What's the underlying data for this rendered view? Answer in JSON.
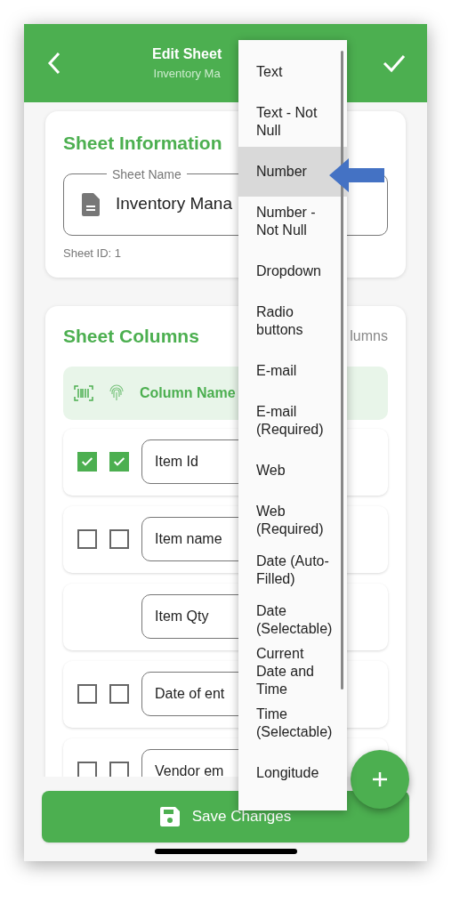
{
  "header": {
    "title": "Edit Sheet",
    "subtitle": "Inventory Ma"
  },
  "sheet_info": {
    "title": "Sheet Information",
    "field_label": "Sheet Name",
    "field_value": "Inventory Mana",
    "sheet_id": "Sheet ID: 1"
  },
  "columns_card": {
    "title": "Sheet Columns",
    "count": "lumns",
    "header_label": "Column Name"
  },
  "rows": [
    {
      "kind": "check",
      "name": "Item Id",
      "scan_checked": true,
      "secure_checked": true
    },
    {
      "kind": "check",
      "name": "Item name",
      "scan_checked": false,
      "secure_checked": false
    },
    {
      "kind": "plain",
      "name": "Item Qty"
    },
    {
      "kind": "check",
      "name": "Date of ent",
      "scan_checked": false,
      "secure_checked": false
    },
    {
      "kind": "check",
      "name": "Vendor em",
      "scan_checked": false,
      "secure_checked": false
    }
  ],
  "save_button": "Save Changes",
  "menu": [
    {
      "label": "Text",
      "selected": false
    },
    {
      "label": "Text - Not Null",
      "selected": false
    },
    {
      "label": "Number",
      "selected": true
    },
    {
      "label": "Number - Not Null",
      "selected": false
    },
    {
      "label": "Dropdown",
      "selected": false
    },
    {
      "label": "Radio buttons",
      "selected": false
    },
    {
      "label": "E-mail",
      "selected": false
    },
    {
      "label": "E-mail (Required)",
      "selected": false
    },
    {
      "label": "Web",
      "selected": false
    },
    {
      "label": "Web (Required)",
      "selected": false
    },
    {
      "label": "Date (Auto-Filled)",
      "selected": false
    },
    {
      "label": "Date (Selectable)",
      "selected": false
    },
    {
      "label": "Current Date and Time",
      "selected": false
    },
    {
      "label": "Time (Selectable)",
      "selected": false
    },
    {
      "label": "Longitude",
      "selected": false
    }
  ]
}
